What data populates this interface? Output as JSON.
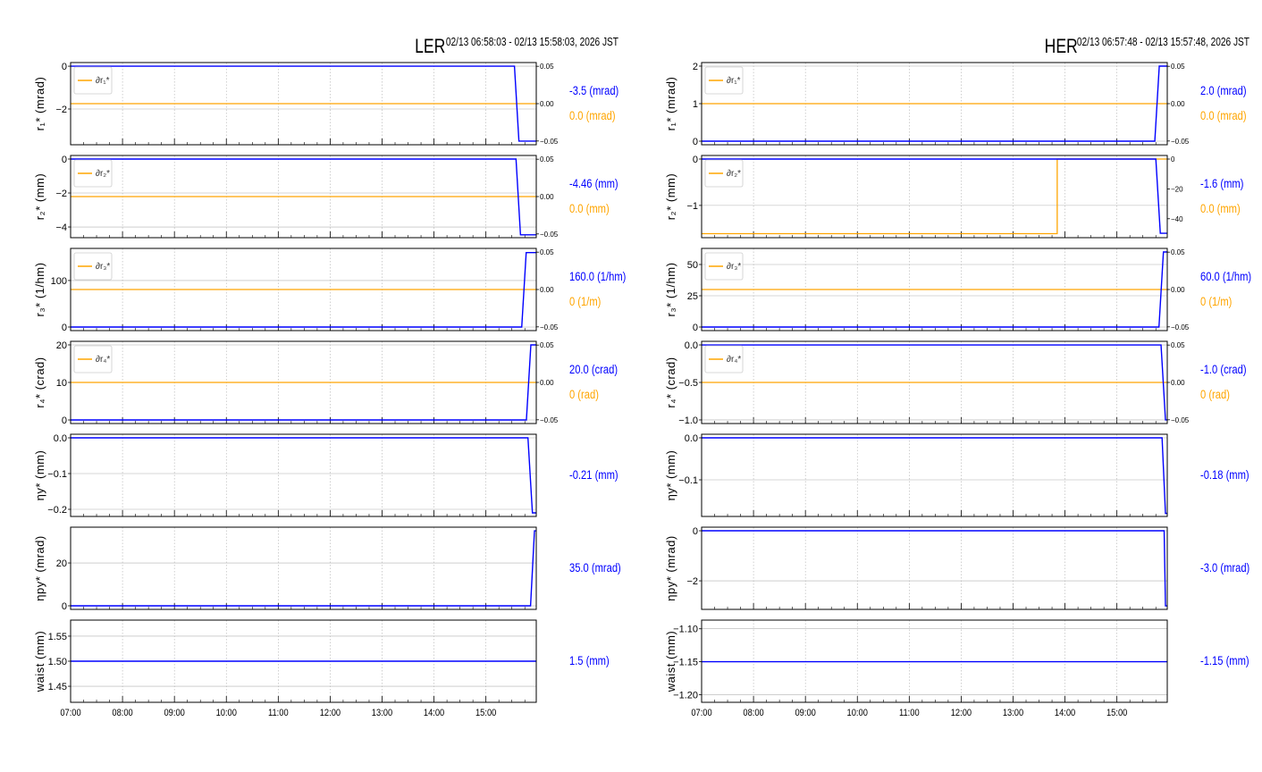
{
  "colors": {
    "primary": "#0000ff",
    "derivative": "#ffa500",
    "grid": "#b0b0b0"
  },
  "chart_data": [
    {
      "type": "line",
      "title": "LER",
      "time_range": "02/13 06:58:03 - 02/13 15:58:03, 2026 JST",
      "x_ticks": [
        "07:00",
        "08:00",
        "09:00",
        "10:00",
        "11:00",
        "12:00",
        "13:00",
        "14:00",
        "15:00"
      ],
      "xlim_hours": [
        7.0,
        15.97
      ],
      "panels": [
        {
          "ylabel": "r₁* (mrad)",
          "legend": "∂r₁*",
          "ylim": [
            -3.67,
            0.17
          ],
          "yticks": [
            0,
            -2
          ],
          "ytick_labels": [
            "0",
            "−2"
          ],
          "series": {
            "name": "r1",
            "step_hour": 15.55,
            "before": 0,
            "after": -3.5
          },
          "deriv": {
            "ylim": [
              -0.055,
              0.055
            ],
            "ticks": [
              0.05,
              0,
              -0.05
            ],
            "tick_labels": [
              "0.05",
              "0.00",
              "−0.05"
            ],
            "step_hour": null,
            "before": 0,
            "after": 0
          },
          "value": "-3.5 (mrad)",
          "deriv_value": "0.0 (mrad)"
        },
        {
          "ylabel": "r₂* (mm)",
          "legend": "∂r₂*",
          "ylim": [
            -4.63,
            0.21
          ],
          "yticks": [
            0,
            -2,
            -4
          ],
          "ytick_labels": [
            "0",
            "−2",
            "−4"
          ],
          "series": {
            "name": "r2",
            "step_hour": 15.58,
            "before": 0,
            "after": -4.46
          },
          "deriv": {
            "ylim": [
              -0.055,
              0.055
            ],
            "ticks": [
              0.05,
              0,
              -0.05
            ],
            "tick_labels": [
              "0.05",
              "0.00",
              "−0.05"
            ],
            "step_hour": null,
            "before": 0,
            "after": 0
          },
          "value": "-4.46 (mm)",
          "deriv_value": "0.0 (mm)"
        },
        {
          "ylabel": "r₃* (1/hm)",
          "legend": "∂r₃*",
          "ylim": [
            -7.7,
            169
          ],
          "yticks": [
            0,
            100
          ],
          "ytick_labels": [
            "0",
            "100"
          ],
          "series": {
            "name": "r3",
            "step_hour": 15.69,
            "before": 0,
            "after": 160
          },
          "deriv": {
            "ylim": [
              -0.055,
              0.055
            ],
            "ticks": [
              0.05,
              0,
              -0.05
            ],
            "tick_labels": [
              "0.05",
              "0.00",
              "−0.05"
            ],
            "step_hour": null,
            "before": 0,
            "after": 0
          },
          "value": "160.0 (1/hm)",
          "deriv_value": "0 (1/m)"
        },
        {
          "ylabel": "r₄* (crad)",
          "legend": "∂r₄*",
          "ylim": [
            -0.95,
            20.95
          ],
          "yticks": [
            0,
            10,
            20
          ],
          "ytick_labels": [
            "0",
            "10",
            "20"
          ],
          "series": {
            "name": "r4",
            "step_hour": 15.78,
            "before": 0,
            "after": 20
          },
          "deriv": {
            "ylim": [
              -0.055,
              0.055
            ],
            "ticks": [
              0.05,
              0,
              -0.05
            ],
            "tick_labels": [
              "0.05",
              "0.00",
              "−0.05"
            ],
            "step_hour": null,
            "before": 0,
            "after": 0
          },
          "value": "20.0 (crad)",
          "deriv_value": "0 (rad)"
        },
        {
          "ylabel": "ηy* (mm)",
          "legend": null,
          "ylim": [
            -0.22,
            0.01
          ],
          "yticks": [
            0,
            -0.1,
            -0.2
          ],
          "ytick_labels": [
            "0.0",
            "−0.1",
            "−0.2"
          ],
          "series": {
            "name": "eta_y",
            "step_hour": 15.81,
            "before": 0,
            "after": -0.21
          },
          "deriv": null,
          "value": "-0.21 (mm)",
          "deriv_value": null
        },
        {
          "ylabel": "ηpy* (mrad)",
          "legend": null,
          "ylim": [
            -1.67,
            36.7
          ],
          "yticks": [
            0,
            20
          ],
          "ytick_labels": [
            "0",
            "20"
          ],
          "series": {
            "name": "eta_py",
            "step_hour": 15.86,
            "before": 0,
            "after": 35
          },
          "deriv": null,
          "value": "35.0 (mrad)",
          "deriv_value": null
        },
        {
          "ylabel": "waist (mm)",
          "legend": null,
          "ylim": [
            1.418,
            1.582
          ],
          "yticks": [
            1.55,
            1.5,
            1.45
          ],
          "ytick_labels": [
            "1.55",
            "1.50",
            "1.45"
          ],
          "series": {
            "name": "waist",
            "step_hour": null,
            "before": 1.5,
            "after": 1.5
          },
          "deriv": null,
          "value": "1.5 (mm)",
          "deriv_value": null
        }
      ]
    },
    {
      "type": "line",
      "title": "HER",
      "time_range": "02/13 06:57:48 - 02/13 15:57:48, 2026 JST",
      "x_ticks": [
        "07:00",
        "08:00",
        "09:00",
        "10:00",
        "11:00",
        "12:00",
        "13:00",
        "14:00",
        "15:00"
      ],
      "xlim_hours": [
        7.0,
        15.97
      ],
      "panels": [
        {
          "ylabel": "r₁* (mrad)",
          "legend": "∂r₁*",
          "ylim": [
            -0.095,
            2.095
          ],
          "yticks": [
            2,
            1,
            0
          ],
          "ytick_labels": [
            "2",
            "1",
            "0"
          ],
          "series": {
            "name": "r1",
            "step_hour": 15.73,
            "before": 0,
            "after": 2.0
          },
          "deriv": {
            "ylim": [
              -0.055,
              0.055
            ],
            "ticks": [
              0.05,
              0,
              -0.05
            ],
            "tick_labels": [
              "0.05",
              "0.00",
              "−0.05"
            ],
            "step_hour": null,
            "before": 0,
            "after": 0
          },
          "value": "2.0 (mrad)",
          "deriv_value": "0.0 (mrad)"
        },
        {
          "ylabel": "r₂* (mm)",
          "legend": "∂r₂*",
          "ylim": [
            -1.696,
            0.077
          ],
          "yticks": [
            0,
            -1
          ],
          "ytick_labels": [
            "0",
            "−1"
          ],
          "series": {
            "name": "r2",
            "step_hour": 15.75,
            "before": 0,
            "after": -1.6
          },
          "deriv": {
            "ylim": [
              -52.7,
              2.4
            ],
            "ticks": [
              0,
              -20,
              -40
            ],
            "tick_labels": [
              "0",
              "−20",
              "−40"
            ],
            "step_hour": 13.85,
            "before": -50,
            "after": 0
          },
          "value": "-1.6 (mm)",
          "deriv_value": "0.0 (mm)"
        },
        {
          "ylabel": "r₃* (1/hm)",
          "legend": "∂r₃*",
          "ylim": [
            -2.86,
            62.86
          ],
          "yticks": [
            50,
            25,
            0
          ],
          "ytick_labels": [
            "50",
            "25",
            "0"
          ],
          "series": {
            "name": "r3",
            "step_hour": 15.81,
            "before": 0,
            "after": 60
          },
          "deriv": {
            "ylim": [
              -0.055,
              0.055
            ],
            "ticks": [
              0.05,
              0,
              -0.05
            ],
            "tick_labels": [
              "0.05",
              "0.00",
              "−0.05"
            ],
            "step_hour": null,
            "before": 0,
            "after": 0
          },
          "value": "60.0 (1/hm)",
          "deriv_value": "0 (1/m)"
        },
        {
          "ylabel": "r₄* (crad)",
          "legend": "∂r₄*",
          "ylim": [
            -1.048,
            0.048
          ],
          "yticks": [
            0,
            -0.5,
            -1
          ],
          "ytick_labels": [
            "0.0",
            "−0.5",
            "−1.0"
          ],
          "series": {
            "name": "r4",
            "step_hour": 15.85,
            "before": 0,
            "after": -1.0
          },
          "deriv": {
            "ylim": [
              -0.055,
              0.055
            ],
            "ticks": [
              0.05,
              0,
              -0.05
            ],
            "tick_labels": [
              "0.05",
              "0.00",
              "−0.05"
            ],
            "step_hour": null,
            "before": 0,
            "after": 0
          },
          "value": "-1.0 (crad)",
          "deriv_value": "0 (rad)"
        },
        {
          "ylabel": "ηy* (mm)",
          "legend": null,
          "ylim": [
            -0.1872,
            0.0085
          ],
          "yticks": [
            0,
            -0.1
          ],
          "ytick_labels": [
            "0.0",
            "−0.1"
          ],
          "series": {
            "name": "eta_y",
            "step_hour": 15.87,
            "before": 0,
            "after": -0.18
          },
          "deriv": null,
          "value": "-0.18 (mm)",
          "deriv_value": null
        },
        {
          "ylabel": "ηpy* (mrad)",
          "legend": null,
          "ylim": [
            -3.14,
            0.143
          ],
          "yticks": [
            0,
            -2
          ],
          "ytick_labels": [
            "0",
            "−2"
          ],
          "series": {
            "name": "eta_py",
            "step_hour": 15.91,
            "before": 0,
            "after": -3.0
          },
          "deriv": null,
          "value": "-3.0 (mrad)",
          "deriv_value": null
        },
        {
          "ylabel": "waist (mm)",
          "legend": null,
          "ylim": [
            -1.2116,
            -1.0868
          ],
          "yticks": [
            -1.1,
            -1.15,
            -1.2
          ],
          "ytick_labels": [
            "−1.10",
            "−1.15",
            "−1.20"
          ],
          "series": {
            "name": "waist",
            "step_hour": null,
            "before": -1.15,
            "after": -1.15
          },
          "deriv": null,
          "value": "-1.15 (mm)",
          "deriv_value": null
        }
      ]
    }
  ]
}
